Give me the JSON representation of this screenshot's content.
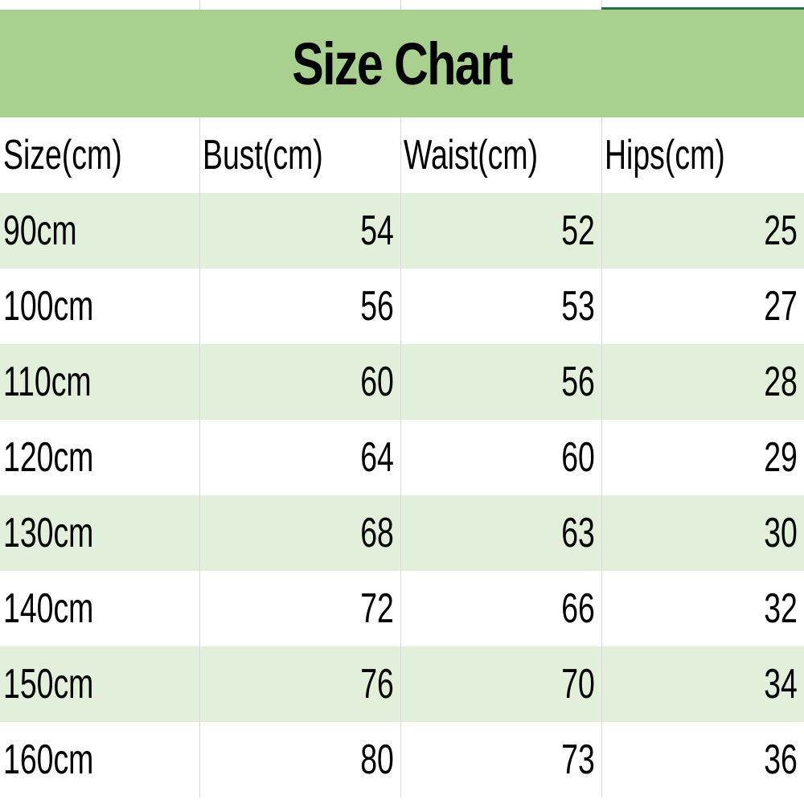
{
  "title": "Size Chart",
  "colors": {
    "title_band": "#a9d08e",
    "row_band": "#e2efda",
    "selection": "#217346",
    "gridline": "#d9d9d9"
  },
  "headers": [
    "Size(cm)",
    "Bust(cm)",
    "Waist(cm)",
    "Hips(cm)"
  ],
  "rows": [
    {
      "size": "90cm",
      "bust": "54",
      "waist": "52",
      "hips": "25"
    },
    {
      "size": "100cm",
      "bust": "56",
      "waist": "53",
      "hips": "27"
    },
    {
      "size": "110cm",
      "bust": "60",
      "waist": "56",
      "hips": "28"
    },
    {
      "size": "120cm",
      "bust": "64",
      "waist": "60",
      "hips": "29"
    },
    {
      "size": "130cm",
      "bust": "68",
      "waist": "63",
      "hips": "30"
    },
    {
      "size": "140cm",
      "bust": "72",
      "waist": "66",
      "hips": "32"
    },
    {
      "size": "150cm",
      "bust": "76",
      "waist": "70",
      "hips": "34"
    },
    {
      "size": "160cm",
      "bust": "80",
      "waist": "73",
      "hips": "36"
    }
  ]
}
